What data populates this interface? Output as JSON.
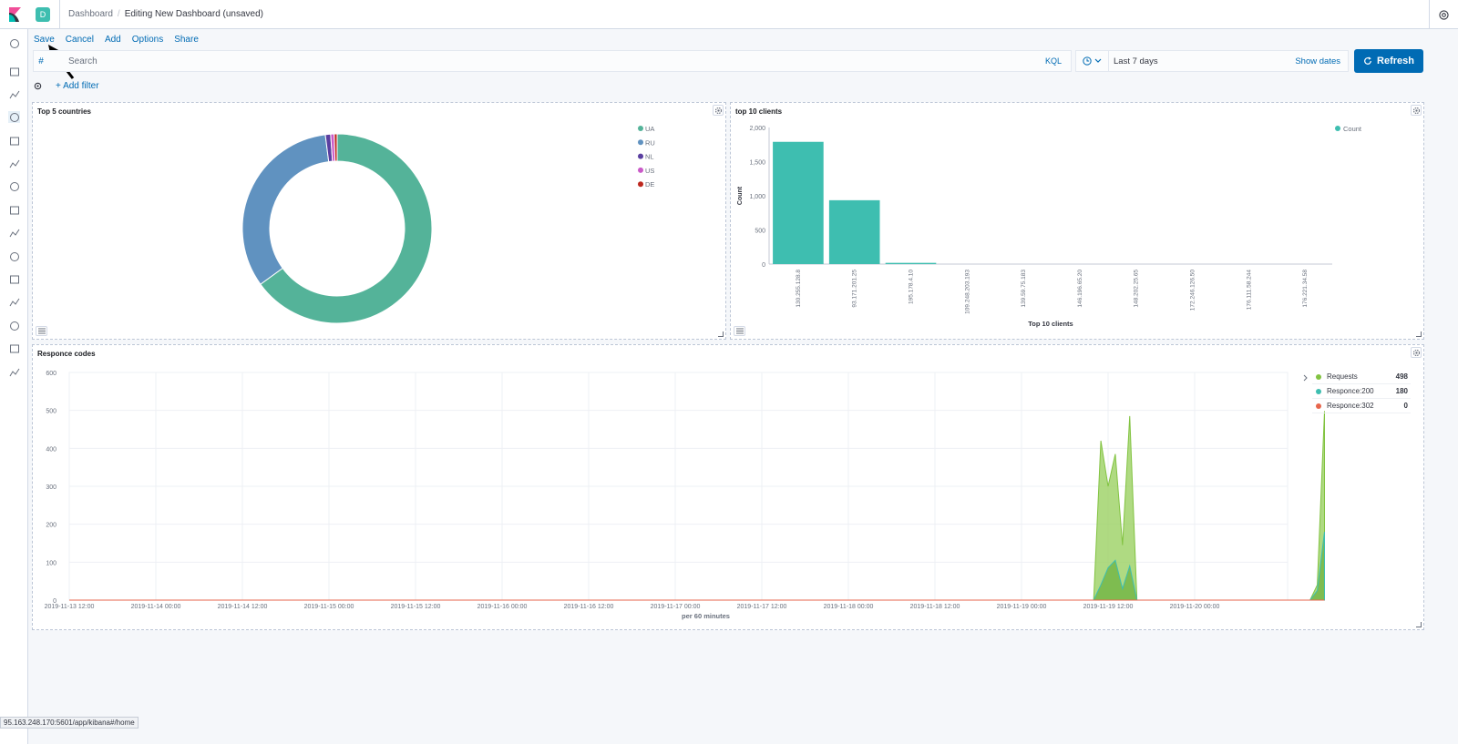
{
  "header": {
    "space_initial": "D",
    "breadcrumb_root": "Dashboard",
    "breadcrumb_current": "Editing New Dashboard (unsaved)"
  },
  "menu": {
    "save": "Save",
    "cancel": "Cancel",
    "add": "Add",
    "options": "Options",
    "share": "Share"
  },
  "query": {
    "hash": "#",
    "placeholder": "Search",
    "language": "KQL"
  },
  "time": {
    "range": "Last 7 days",
    "show_dates": "Show dates",
    "refresh": "Refresh"
  },
  "filters": {
    "add_filter": "+ Add filter"
  },
  "sidenav": {
    "items": [
      "recent-icon",
      "discover-icon",
      "visualize-icon",
      "dashboard-icon",
      "canvas-icon",
      "maps-icon",
      "ml-icon",
      "infrastructure-icon",
      "logs-icon",
      "apm-icon",
      "uptime-icon",
      "siem-icon",
      "dev-tools-icon",
      "monitoring-icon",
      "management-icon"
    ],
    "active": "dashboard-icon"
  },
  "panels": {
    "countries_title": "Top 5 countries",
    "clients_title": "top 10 clients",
    "codes_title": "Responce codes"
  },
  "status_url": "95.163.248.170:5601/app/kibana#/home",
  "colors": {
    "accent": "#006bb4",
    "teal": "#3ebeb0",
    "green": "#54b399"
  },
  "chart_data": [
    {
      "type": "pie",
      "title": "Top 5 countries",
      "donut": true,
      "legend_position": "top-right",
      "slices": [
        {
          "label": "UA",
          "value": 65.0,
          "color": "#54b399"
        },
        {
          "label": "RU",
          "value": 33.0,
          "color": "#6092c0"
        },
        {
          "label": "NL",
          "value": 0.9,
          "color": "#5a3fa0"
        },
        {
          "label": "US",
          "value": 0.6,
          "color": "#ca5ac8"
        },
        {
          "label": "DE",
          "value": 0.5,
          "color": "#bd271e"
        }
      ]
    },
    {
      "type": "bar",
      "title": "top 10 clients",
      "xlabel": "Top 10 clients",
      "ylabel": "Count",
      "ylim": [
        0,
        2000
      ],
      "yticks": [
        "0",
        "500",
        "1,000",
        "1,500",
        "2,000"
      ],
      "legend_position": "top-right",
      "series": [
        {
          "name": "Count",
          "color": "#3ebeb0"
        }
      ],
      "categories": [
        "130.255.128.8",
        "93.171.201.25",
        "195.178.4.10",
        "109.248.203.193",
        "139.59.75.183",
        "146.196.65.20",
        "148.202.25.65",
        "172.246.126.50",
        "176.111.58.244",
        "176.221.34.58"
      ],
      "values": [
        1790,
        935,
        18,
        0,
        0,
        0,
        0,
        0,
        0,
        0
      ]
    },
    {
      "type": "area",
      "title": "Responce codes",
      "xlabel": "per 60 minutes",
      "ylim": [
        0,
        600
      ],
      "yticks": [
        "0",
        "100",
        "200",
        "300",
        "400",
        "500",
        "600"
      ],
      "x_ticks": [
        "2019-11-13 12:00",
        "2019-11-14 00:00",
        "2019-11-14 12:00",
        "2019-11-15 00:00",
        "2019-11-15 12:00",
        "2019-11-16 00:00",
        "2019-11-16 12:00",
        "2019-11-17 00:00",
        "2019-11-17 12:00",
        "2019-11-18 00:00",
        "2019-11-18 12:00",
        "2019-11-19 00:00",
        "2019-11-19 12:00",
        "2019-11-20 00:00"
      ],
      "x_start": "2019-11-13 12:00",
      "series": [
        {
          "name": "Requests",
          "total": "498",
          "color": "#82c341",
          "points": [
            [
              "2019-11-13 12:00",
              0
            ],
            [
              "2019-11-19 10:00",
              0
            ],
            [
              "2019-11-19 11:00",
              420
            ],
            [
              "2019-11-19 12:00",
              300
            ],
            [
              "2019-11-19 13:00",
              385
            ],
            [
              "2019-11-19 14:00",
              145
            ],
            [
              "2019-11-19 15:00",
              485
            ],
            [
              "2019-11-19 16:00",
              0
            ],
            [
              "2019-11-20 16:00",
              0
            ],
            [
              "2019-11-20 17:00",
              40
            ],
            [
              "2019-11-20 18:00",
              498
            ]
          ]
        },
        {
          "name": "Responce:200",
          "total": "180",
          "color": "#3ebeb0",
          "points": [
            [
              "2019-11-13 12:00",
              0
            ],
            [
              "2019-11-19 10:00",
              0
            ],
            [
              "2019-11-19 11:00",
              40
            ],
            [
              "2019-11-19 12:00",
              85
            ],
            [
              "2019-11-19 13:00",
              105
            ],
            [
              "2019-11-19 14:00",
              30
            ],
            [
              "2019-11-19 15:00",
              90
            ],
            [
              "2019-11-19 16:00",
              0
            ],
            [
              "2019-11-20 16:00",
              0
            ],
            [
              "2019-11-20 17:00",
              25
            ],
            [
              "2019-11-20 18:00",
              180
            ]
          ]
        },
        {
          "name": "Responce:302",
          "total": "0",
          "color": "#e7664c",
          "points": [
            [
              "2019-11-13 12:00",
              0
            ],
            [
              "2019-11-20 18:00",
              0
            ]
          ]
        }
      ]
    }
  ]
}
